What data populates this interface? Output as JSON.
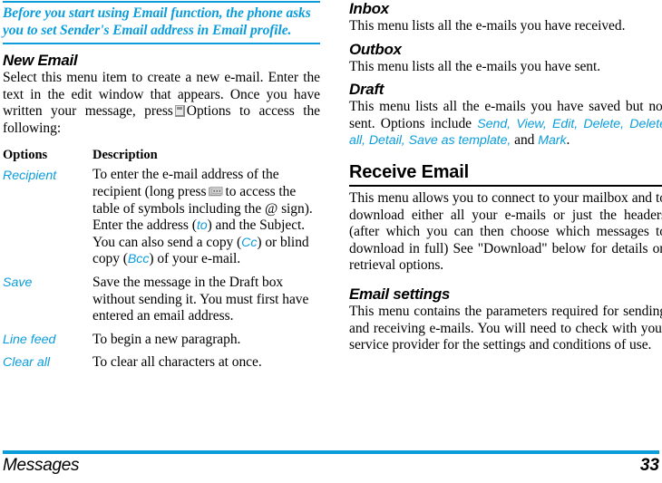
{
  "document": {
    "footer_title": "Messages",
    "page_number": "33",
    "accent_color": "#0b9ddb",
    "text_color": "#000000"
  },
  "left_column": {
    "note": {
      "text": "Before you start using Email function, the phone asks you to set Sender's Email address in Email profile."
    },
    "new_email": {
      "heading": "New Email",
      "intro_part1": "Select this menu item to create a new e-mail. Enter the text in the edit window that appears. Once you have written your message, press",
      "softkey_icon": "softkey-options-icon",
      "intro_part2": "Options to access the following:"
    },
    "options_table": {
      "header_options": "Options",
      "header_description": "Description",
      "rows": [
        {
          "name": "Recipient",
          "desc_part1": "To enter the e-mail address of the recipient (long press",
          "star_key_icon": "star-key-icon",
          "desc_part2": "to access the table of symbols including the @ sign).",
          "desc_line2_a": "Enter the address (",
          "desc_line2_to": "to",
          "desc_line2_b": ") and the Subject. You can also send a copy (",
          "desc_line2_cc": "Cc",
          "desc_line2_c": ") or blind copy (",
          "desc_line2_bcc": "Bcc",
          "desc_line2_d": ") of your e-mail."
        },
        {
          "name": "Save",
          "desc": "Save the message in the Draft box without sending it. You must first have entered an email address."
        },
        {
          "name": "Line feed",
          "desc": "To begin a new paragraph."
        },
        {
          "name": "Clear all",
          "desc": "To clear all characters at once."
        }
      ]
    }
  },
  "right_column": {
    "inbox": {
      "heading": "Inbox",
      "body": "This menu lists all the e-mails you have received."
    },
    "outbox": {
      "heading": "Outbox",
      "body": "This menu lists all the e-mails you have sent."
    },
    "draft": {
      "heading": "Draft",
      "body_part1": "This menu lists all the e-mails you have saved but not sent. Options include",
      "options_list": "Send, View, Edit, Delete, Delete all, Detail, Save as template,",
      "body_part2": "and",
      "options_last": "Mark",
      "body_part3": "."
    },
    "receive_email": {
      "heading": "Receive Email",
      "body": "This menu allows you to connect to your mailbox and to download either all your e-mails or just the headers (after which you can then choose which messages to download in full) See \"Download\" below for details on retrieval options."
    },
    "email_settings": {
      "heading": "Email settings",
      "body": "This menu contains the parameters required for sending and receiving e-mails. You will need to check with your service provider for the settings and conditions of use."
    }
  }
}
